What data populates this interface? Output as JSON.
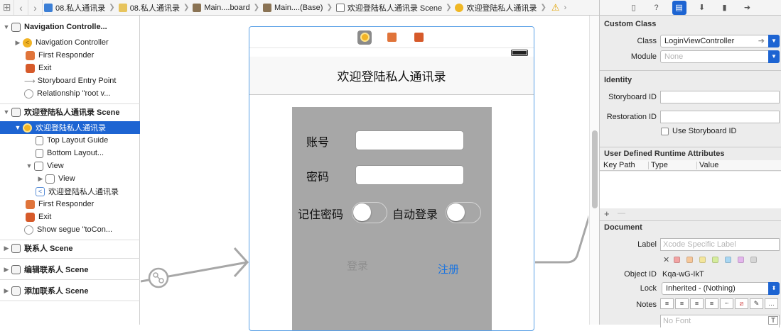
{
  "jumpbar": {
    "items": [
      "08.私人通讯录",
      "08.私人通讯录",
      "Main....board",
      "Main....(Base)",
      "欢迎登陆私人通讯录 Scene",
      "欢迎登陆私人通讯录"
    ]
  },
  "outline": {
    "rows": [
      {
        "label": "Navigation Controlle...",
        "icon": "scene-icon"
      },
      {
        "label": "Navigation Controller",
        "icon": "navigation-controller-icon"
      },
      {
        "label": "First Responder",
        "icon": "first-responder-icon"
      },
      {
        "label": "Exit",
        "icon": "exit-icon"
      },
      {
        "label": "Storyboard Entry Point",
        "icon": "entry-arrow-icon"
      },
      {
        "label": "Relationship \"root v...",
        "icon": "relationship-icon"
      },
      {
        "label": "欢迎登陆私人通讯录 Scene",
        "icon": "scene-icon"
      },
      {
        "label": "欢迎登陆私人通讯录",
        "icon": "view-controller-icon"
      },
      {
        "label": "Top Layout Guide",
        "icon": "layout-guide-icon"
      },
      {
        "label": "Bottom Layout...",
        "icon": "layout-guide-icon"
      },
      {
        "label": "View",
        "icon": "view-icon"
      },
      {
        "label": "View",
        "icon": "view-icon"
      },
      {
        "label": "欢迎登陆私人通讯录",
        "icon": "navigation-item-icon"
      },
      {
        "label": "First Responder",
        "icon": "first-responder-icon"
      },
      {
        "label": "Exit",
        "icon": "exit-icon"
      },
      {
        "label": "Show segue \"toCon...",
        "icon": "segue-icon"
      },
      {
        "label": "联系人 Scene",
        "icon": "scene-icon"
      },
      {
        "label": "编辑联系人 Scene",
        "icon": "scene-icon"
      },
      {
        "label": "添加联系人 Scene",
        "icon": "scene-icon"
      }
    ]
  },
  "canvas": {
    "nav_title": "欢迎登陆私人通讯录",
    "account_label": "账号",
    "password_label": "密码",
    "remember_label": "记住密码",
    "autologin_label": "自动登录",
    "login_button": "登录",
    "register_button": "注册"
  },
  "inspector": {
    "custom_class": {
      "heading": "Custom Class",
      "class_label": "Class",
      "class_value": "LoginViewController",
      "module_label": "Module",
      "module_placeholder": "None"
    },
    "identity": {
      "heading": "Identity",
      "storyboard_id_label": "Storyboard ID",
      "restoration_id_label": "Restoration ID",
      "use_storyboard_id": "Use Storyboard ID"
    },
    "runtime": {
      "heading": "User Defined Runtime Attributes",
      "col_keypath": "Key Path",
      "col_type": "Type",
      "col_value": "Value",
      "add": "+",
      "remove": "—"
    },
    "document": {
      "heading": "Document",
      "label_label": "Label",
      "label_placeholder": "Xcode Specific Label",
      "clear": "✕",
      "swatch_colors": [
        "#f2a3a3",
        "#f6c79a",
        "#f3e59b",
        "#d5ec9c",
        "#a8d6f2",
        "#e3b6ec",
        "#d6d6d6"
      ],
      "object_id_label": "Object ID",
      "object_id_value": "Kqa-wG-IkT",
      "lock_label": "Lock",
      "lock_value": "Inherited - (Nothing)",
      "notes_label": "Notes",
      "font_placeholder": "No Font"
    }
  },
  "colors": {
    "accent": "#1d64d2",
    "selection": "#1d64d2",
    "placeholder_gray": "#a7a7a7",
    "link_blue": "#1a74e0"
  }
}
